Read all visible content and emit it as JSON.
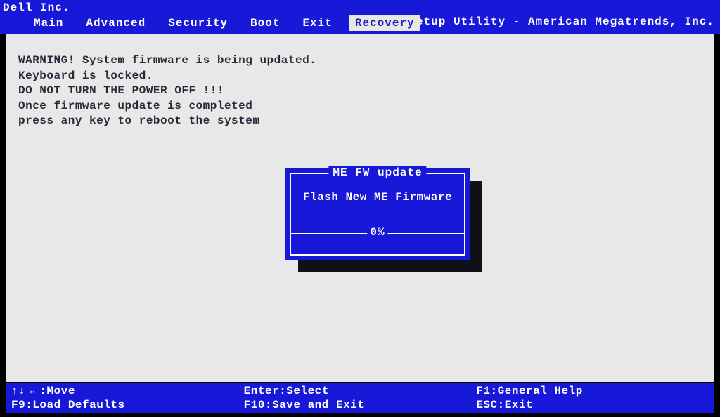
{
  "header": {
    "vendor": "Dell Inc.",
    "utility_title": "Aptio Setup Utility - American Megatrends, Inc."
  },
  "tabs": {
    "main": "Main",
    "advanced": "Advanced",
    "security": "Security",
    "boot": "Boot",
    "exit": "Exit",
    "recovery": "Recovery"
  },
  "warning": "WARNING! System firmware is being updated.\nKeyboard is locked.\nDO NOT TURN THE POWER OFF !!!\nOnce firmware update is completed\npress any key to reboot the system",
  "dialog": {
    "title": "ME FW update",
    "action": "Flash New ME Firmware",
    "progress": "0%"
  },
  "footer": {
    "col1_row1": "↑↓→←:Move",
    "col1_row2": "F9:Load Defaults",
    "col2_row1": "Enter:Select",
    "col2_row2": "F10:Save and Exit",
    "col3_row1": "F1:General Help",
    "col3_row2": "ESC:Exit"
  }
}
